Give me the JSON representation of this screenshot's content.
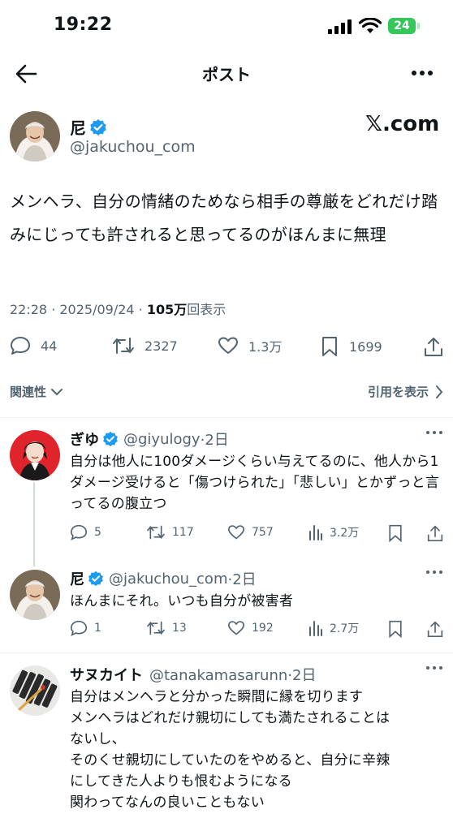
{
  "status_bar": {
    "time": "19:22",
    "battery": "24"
  },
  "header": {
    "title": "ポスト"
  },
  "post": {
    "author_name": "尼",
    "author_handle": "@jakuchou_com",
    "brand": "𝕏.com",
    "text": "メンヘラ、自分の情緒のためなら相手の尊厳をどれだけ踏みにじっても許されると思ってるのがほんまに無理",
    "timestamp": "22:28 · 2025/09/24 · ",
    "views_count": "105万",
    "views_label": "回表示",
    "stats": {
      "replies": "44",
      "reposts": "2327",
      "likes": "1.3万",
      "bookmarks": "1699"
    }
  },
  "filters": {
    "sort_label": "関連性",
    "quotes_label": "引用を表示"
  },
  "replies": [
    {
      "name": "ぎゆ",
      "handle": "@giyulogy",
      "time": "·2日",
      "text": "自分は他人に100ダメージくらい与えてるのに、他人から1ダメージ受けると「傷つけられた」「悲しい」とかずっと言ってるの腹立つ",
      "stats": {
        "replies": "5",
        "reposts": "117",
        "likes": "757",
        "views": "3.2万"
      }
    },
    {
      "name": "尼",
      "handle": "@jakuchou_com",
      "time": "·2日",
      "text": "ほんまにそれ。いつも自分が被害者",
      "stats": {
        "replies": "1",
        "reposts": "13",
        "likes": "192",
        "views": "2.7万"
      }
    },
    {
      "name": "サヌカイト",
      "handle": "@tanakamasarunn",
      "time": "·2日",
      "lines": [
        "自分はメンヘラと分かった瞬間に縁を切ります",
        "メンヘラはどれだけ親切にしても満たされることは",
        "ないし、",
        "そのくせ親切にしていたのをやめると、自分に辛辣",
        "にしてきた人よりも恨むようになる",
        "関わってなんの良いこともない"
      ]
    }
  ],
  "colors": {
    "verified": "#1d9bf0",
    "battery": "#35c759",
    "muted": "#536471",
    "text": "#0f1419"
  }
}
